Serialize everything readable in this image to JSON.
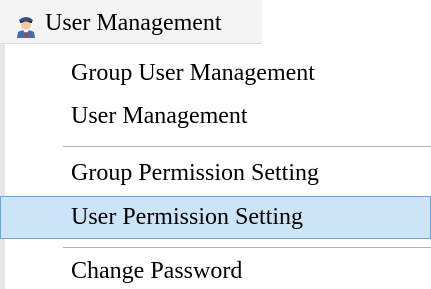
{
  "header": {
    "title": "User Management",
    "icon": "user-icon"
  },
  "menu": {
    "items": [
      {
        "label": "Group User Management",
        "highlighted": false
      },
      {
        "label": "User Management",
        "highlighted": false
      },
      {
        "label": "Group Permission Setting",
        "highlighted": false
      },
      {
        "label": "User Permission Setting",
        "highlighted": true
      },
      {
        "label": "Change Password",
        "highlighted": false
      }
    ]
  },
  "colors": {
    "highlight_bg": "#cce4f7",
    "highlight_border": "#6ea5d8"
  }
}
